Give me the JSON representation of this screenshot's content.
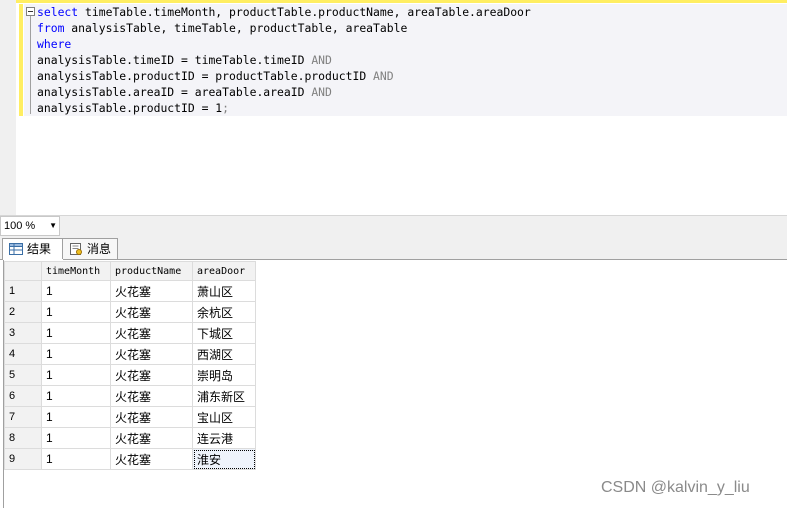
{
  "editor": {
    "lines": [
      [
        {
          "t": "select",
          "c": "kw"
        },
        {
          "t": " timeTable.timeMonth, productTable.productName, areaTable.areaDoor",
          "c": ""
        }
      ],
      [
        {
          "t": "from",
          "c": "kw"
        },
        {
          "t": " analysisTable, timeTable, productTable, areaTable",
          "c": ""
        }
      ],
      [
        {
          "t": "where",
          "c": "kw"
        }
      ],
      [
        {
          "t": "analysisTable.timeID = timeTable.timeID ",
          "c": ""
        },
        {
          "t": "AND",
          "c": "gray"
        }
      ],
      [
        {
          "t": "analysisTable.productID = productTable.productID ",
          "c": ""
        },
        {
          "t": "AND",
          "c": "gray"
        }
      ],
      [
        {
          "t": "analysisTable.areaID = areaTable.areaID ",
          "c": ""
        },
        {
          "t": "AND",
          "c": "gray"
        }
      ],
      [
        {
          "t": "analysisTable.productID = 1",
          "c": ""
        },
        {
          "t": ";",
          "c": "gray"
        }
      ]
    ]
  },
  "zoom": {
    "value": "100 %"
  },
  "tabs": [
    {
      "label": "结果",
      "icon": "grid-icon"
    },
    {
      "label": "消息",
      "icon": "message-icon"
    }
  ],
  "results": {
    "columns": [
      "timeMonth",
      "productName",
      "areaDoor"
    ],
    "rows": [
      {
        "n": "1",
        "timeMonth": "1",
        "productName": "火花塞",
        "areaDoor": "萧山区"
      },
      {
        "n": "2",
        "timeMonth": "1",
        "productName": "火花塞",
        "areaDoor": "余杭区"
      },
      {
        "n": "3",
        "timeMonth": "1",
        "productName": "火花塞",
        "areaDoor": "下城区"
      },
      {
        "n": "4",
        "timeMonth": "1",
        "productName": "火花塞",
        "areaDoor": "西湖区"
      },
      {
        "n": "5",
        "timeMonth": "1",
        "productName": "火花塞",
        "areaDoor": "崇明岛"
      },
      {
        "n": "6",
        "timeMonth": "1",
        "productName": "火花塞",
        "areaDoor": "浦东新区"
      },
      {
        "n": "7",
        "timeMonth": "1",
        "productName": "火花塞",
        "areaDoor": "宝山区"
      },
      {
        "n": "8",
        "timeMonth": "1",
        "productName": "火花塞",
        "areaDoor": "连云港"
      },
      {
        "n": "9",
        "timeMonth": "1",
        "productName": "火花塞",
        "areaDoor": "淮安"
      }
    ]
  },
  "watermark": "CSDN @kalvin_y_liu"
}
